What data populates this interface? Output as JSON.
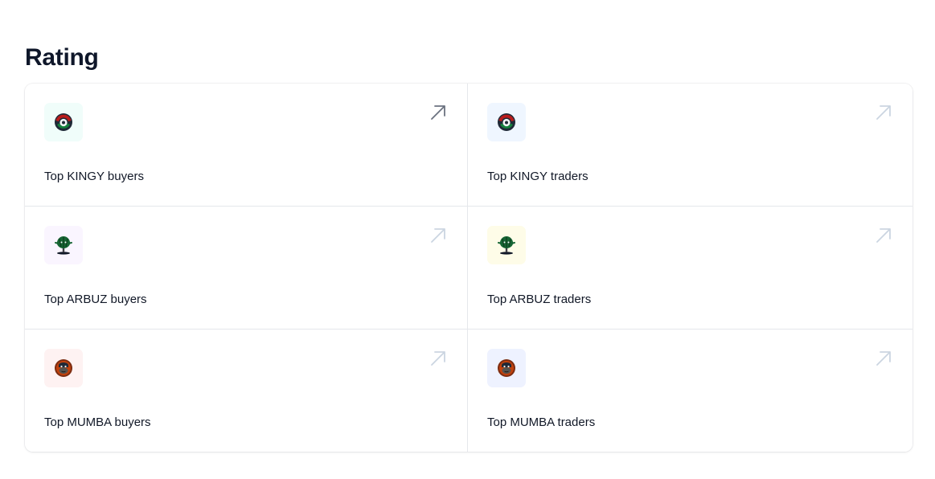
{
  "page": {
    "title": "Rating"
  },
  "cards": [
    {
      "label": "Top KINGY buyers",
      "token": "kingy-token-icon",
      "tint": "#f0fdfa"
    },
    {
      "label": "Top KINGY traders",
      "token": "kingy-token-icon",
      "tint": "#eff6ff"
    },
    {
      "label": "Top ARBUZ buyers",
      "token": "arbuz-token-icon",
      "tint": "#faf5ff"
    },
    {
      "label": "Top ARBUZ traders",
      "token": "arbuz-token-icon",
      "tint": "#fefce8"
    },
    {
      "label": "Top MUMBA buyers",
      "token": "mumba-token-icon",
      "tint": "#fef2f2"
    },
    {
      "label": "Top MUMBA traders",
      "token": "mumba-token-icon",
      "tint": "#eef2ff"
    }
  ],
  "link_icon": "arrow-up-right-icon",
  "colors": {
    "heading": "#0f172a",
    "text": "#111827",
    "divider": "#e5e7eb",
    "arrow_active": "#6b7280",
    "arrow_muted": "#cbd5e1"
  }
}
